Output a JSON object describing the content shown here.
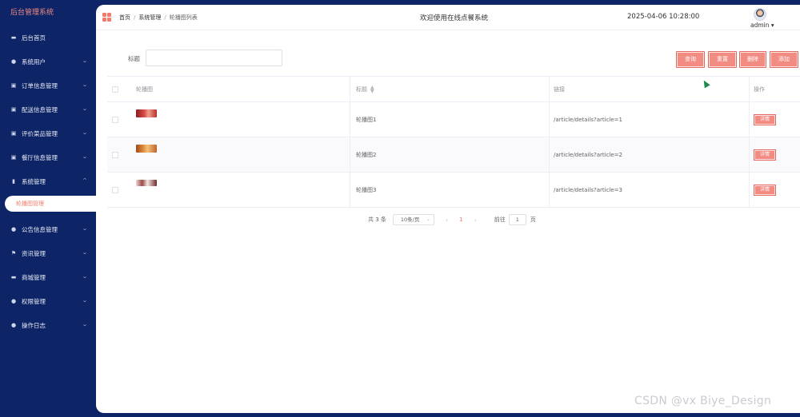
{
  "sidebar": {
    "brand": "后台管理系统",
    "items": [
      {
        "label": "后台首页",
        "icon": "monitor-icon",
        "chevron": false
      },
      {
        "label": "系统用户",
        "icon": "user-icon",
        "chevron": true
      },
      {
        "label": "订单信息管理",
        "icon": "chart-icon",
        "chevron": true
      },
      {
        "label": "配送信息管理",
        "icon": "chart-icon",
        "chevron": true
      },
      {
        "label": "评价菜品管理",
        "icon": "chart-icon",
        "chevron": true
      },
      {
        "label": "餐厅信息管理",
        "icon": "chart-icon",
        "chevron": true
      },
      {
        "label": "系统管理",
        "icon": "bar-chart-icon",
        "chevron": true,
        "expanded": true
      }
    ],
    "active_sub": "轮播图管理",
    "items_after": [
      {
        "label": "公告信息管理",
        "icon": "info-icon"
      },
      {
        "label": "资讯管理",
        "icon": "flag-icon"
      },
      {
        "label": "商城管理",
        "icon": "monitor-icon"
      },
      {
        "label": "权限管理",
        "icon": "user-icon"
      },
      {
        "label": "操作日志",
        "icon": "user-icon"
      }
    ]
  },
  "header": {
    "breadcrumb": [
      "首页",
      "系统管理",
      "轮播图列表"
    ],
    "welcome": "欢迎使用在线点餐系统",
    "datetime": "2025-04-06 10:28:00",
    "user": "admin"
  },
  "search": {
    "label": "标题",
    "value": ""
  },
  "buttons": {
    "query": "查询",
    "reset": "重置",
    "delete": "删除",
    "add": "添加"
  },
  "table": {
    "headers": [
      "轮播图",
      "标题",
      "链接",
      "操作"
    ],
    "rows": [
      {
        "title": "轮播图1",
        "link": "/article/details?article=1",
        "action": "详情",
        "thumb_color": "#c2423d"
      },
      {
        "title": "轮播图2",
        "link": "/article/details?article=2",
        "action": "详情",
        "thumb_color": "#d57a3f"
      },
      {
        "title": "轮播图3",
        "link": "/article/details?article=3",
        "action": "详情",
        "thumb_color": "#9d5a55"
      }
    ]
  },
  "pagination": {
    "total": "共 3 条",
    "page_size": "10条/页",
    "current_page": "1",
    "goto_label": "前往",
    "goto_value": "1",
    "unit": "页"
  },
  "watermark": "CSDN @vx Biye_Design"
}
